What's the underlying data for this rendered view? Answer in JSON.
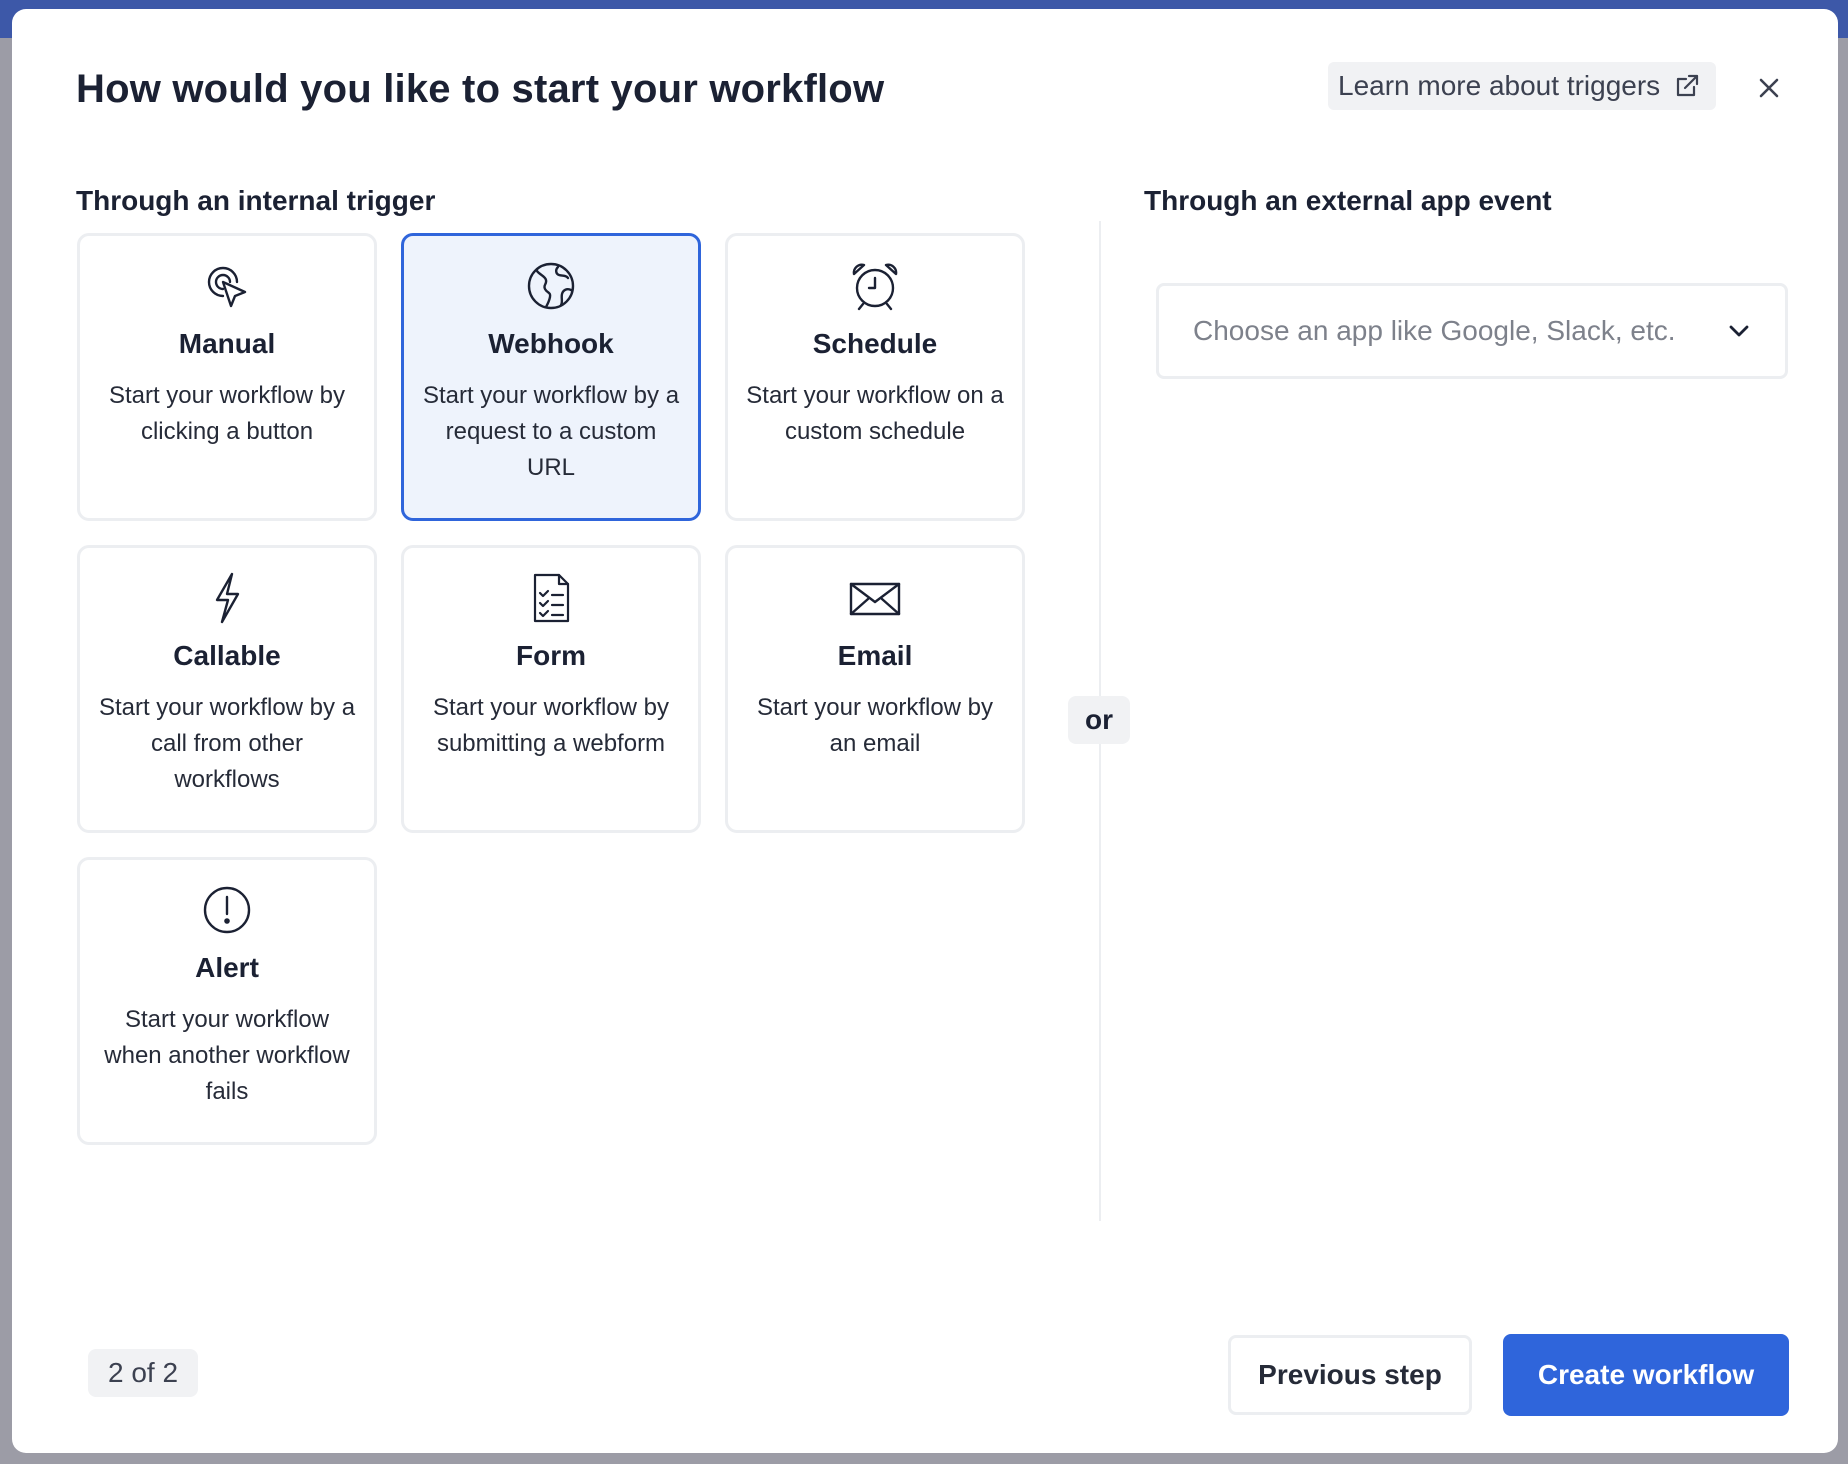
{
  "dialog": {
    "title": "How would you like to start your workflow",
    "learn_more": "Learn more about triggers",
    "close_icon": "close-icon"
  },
  "internal": {
    "label": "Through an internal trigger",
    "cards": [
      {
        "id": "manual",
        "icon": "cursor-click-icon",
        "title": "Manual",
        "desc": "Start your workflow by clicking a button",
        "selected": false
      },
      {
        "id": "webhook",
        "icon": "globe-icon",
        "title": "Webhook",
        "desc": "Start your workflow by a request to a custom URL",
        "selected": true
      },
      {
        "id": "schedule",
        "icon": "alarm-clock-icon",
        "title": "Schedule",
        "desc": "Start your workflow on a custom schedule",
        "selected": false
      },
      {
        "id": "callable",
        "icon": "lightning-icon",
        "title": "Callable",
        "desc": "Start your workflow by a call from other workflows",
        "selected": false
      },
      {
        "id": "form",
        "icon": "form-checklist-icon",
        "title": "Form",
        "desc": "Start your workflow by submitting a webform",
        "selected": false
      },
      {
        "id": "email",
        "icon": "envelope-icon",
        "title": "Email",
        "desc": "Start your workflow by an email",
        "selected": false
      },
      {
        "id": "alert",
        "icon": "alert-circle-icon",
        "title": "Alert",
        "desc": "Start your workflow when another workflow fails",
        "selected": false
      }
    ]
  },
  "separator": "or",
  "external": {
    "label": "Through an external app event",
    "select_placeholder": "Choose an app like Google, Slack, etc."
  },
  "footer": {
    "step": "2 of 2",
    "previous": "Previous step",
    "create": "Create workflow"
  },
  "colors": {
    "accent": "#2f65db",
    "selected_bg": "#eef3fc",
    "text": "#1b2133"
  }
}
